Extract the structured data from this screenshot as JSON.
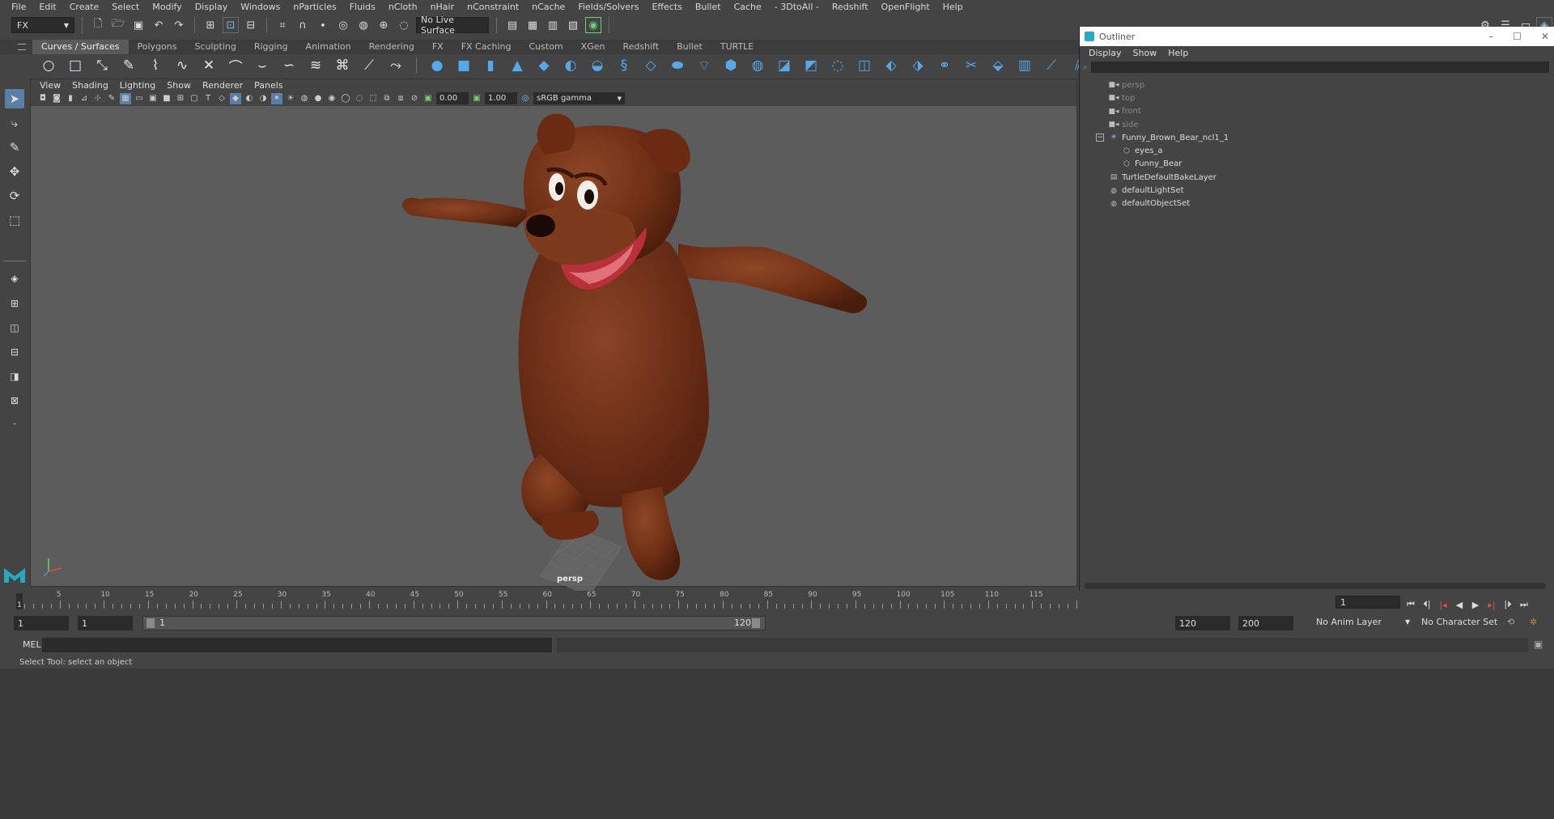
{
  "menubar": [
    "File",
    "Edit",
    "Create",
    "Select",
    "Modify",
    "Display",
    "Windows",
    "nParticles",
    "Fluids",
    "nCloth",
    "nHair",
    "nConstraint",
    "nCache",
    "Fields/Solvers",
    "Effects",
    "Bullet",
    "Cache",
    "- 3DtoAll -",
    "Redshift",
    "OpenFlight",
    "Help"
  ],
  "status": {
    "menu_set": "FX",
    "live_surface": "No Live Surface"
  },
  "shelf_tabs": [
    "Curves / Surfaces",
    "Polygons",
    "Sculpting",
    "Rigging",
    "Animation",
    "Rendering",
    "FX",
    "FX Caching",
    "Custom",
    "XGen",
    "Redshift",
    "Bullet",
    "TURTLE"
  ],
  "viewport": {
    "menu": [
      "View",
      "Shading",
      "Lighting",
      "Show",
      "Renderer",
      "Panels"
    ],
    "exposure": "0.00",
    "gamma": "1.00",
    "color_space": "sRGB gamma",
    "camera_label": "persp"
  },
  "outliner": {
    "title": "Outliner",
    "menu": [
      "Display",
      "Show",
      "Help"
    ],
    "items": [
      {
        "label": "persp",
        "icon": "camera-icon",
        "indent": 0,
        "dim": true
      },
      {
        "label": "top",
        "icon": "camera-icon",
        "indent": 0,
        "dim": true
      },
      {
        "label": "front",
        "icon": "camera-icon",
        "indent": 0,
        "dim": true
      },
      {
        "label": "side",
        "icon": "camera-icon",
        "indent": 0,
        "dim": true
      },
      {
        "label": "Funny_Brown_Bear_ncl1_1",
        "icon": "joint-icon",
        "indent": 0,
        "dim": false
      },
      {
        "label": "eyes_a",
        "icon": "mesh-icon",
        "indent": 1,
        "dim": false
      },
      {
        "label": "Funny_Bear",
        "icon": "mesh-icon",
        "indent": 1,
        "dim": false
      },
      {
        "label": "TurtleDefaultBakeLayer",
        "icon": "bake-layer-icon",
        "indent": 0,
        "dim": false
      },
      {
        "label": "defaultLightSet",
        "icon": "set-icon",
        "indent": 0,
        "dim": false
      },
      {
        "label": "defaultObjectSet",
        "icon": "set-icon",
        "indent": 0,
        "dim": false
      }
    ]
  },
  "timeline": {
    "labels": [
      "5",
      "10",
      "15",
      "20",
      "25",
      "30",
      "35",
      "40",
      "45",
      "50",
      "55",
      "60",
      "65",
      "70",
      "75",
      "80",
      "85",
      "90",
      "95",
      "100",
      "105",
      "110",
      "115"
    ],
    "current_frame": "1",
    "frame_field": "1"
  },
  "range": {
    "start": "1",
    "playback_start": "1",
    "slider_start": "1",
    "slider_end": "120",
    "playback_end": "120",
    "end": "200",
    "anim_layer": "No Anim Layer",
    "character_set": "No Character Set"
  },
  "command": {
    "label": "MEL"
  },
  "help_line": "Select Tool: select an object",
  "colors": {
    "accent": "#5a7fa5",
    "shelf_icon": "#57a8e8",
    "bear_fur": "#7a3318"
  }
}
